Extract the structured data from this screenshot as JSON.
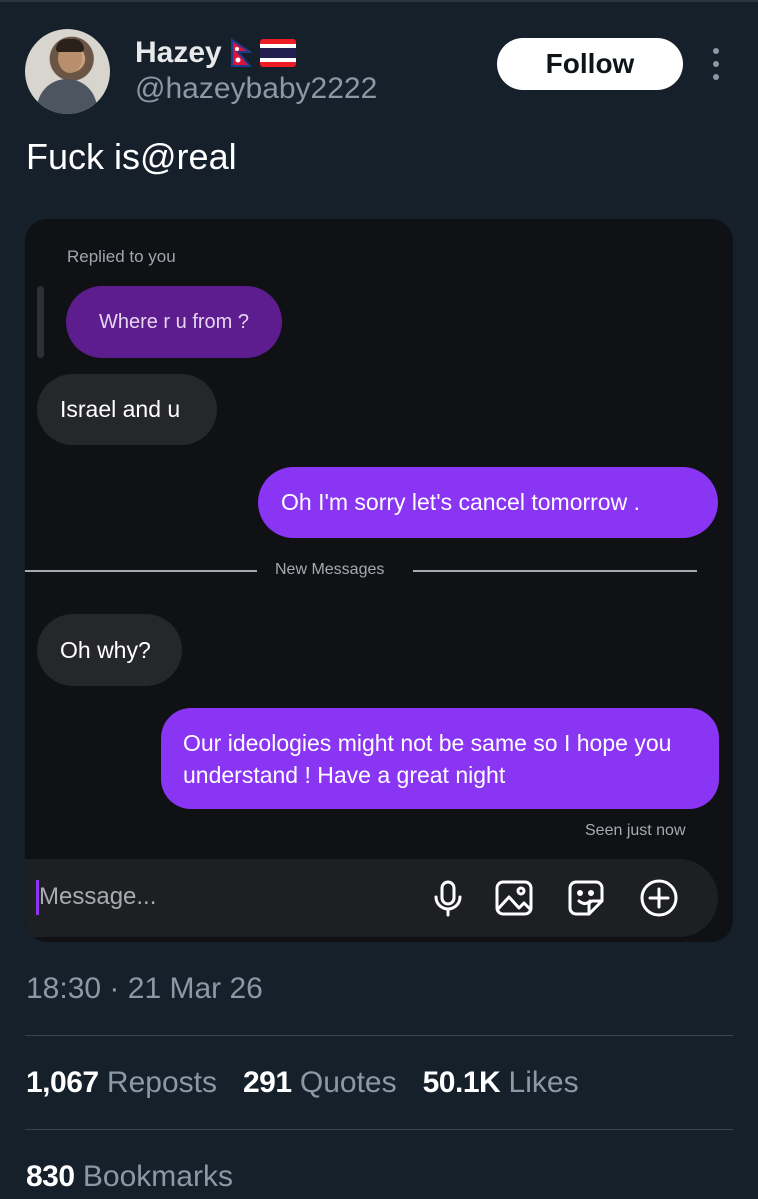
{
  "author": {
    "name": "Hazey",
    "flags": [
      "nepal-flag",
      "thailand-flag"
    ],
    "handle": "@hazeybaby2222"
  },
  "follow_label": "Follow",
  "tweet_text": "Fuck is@real",
  "dm": {
    "replied_label": "Replied to you",
    "messages": [
      {
        "side": "quoted",
        "text": "Where r u from ?"
      },
      {
        "side": "in",
        "text": "Israel and u"
      },
      {
        "side": "out",
        "text": "Oh I'm sorry let's cancel tomorrow ."
      },
      {
        "side": "in",
        "text": "Oh why?"
      },
      {
        "side": "out",
        "text": "Our ideologies might not be same so I hope you understand ! Have a great night"
      }
    ],
    "divider_label": "New Messages",
    "seen_label": "Seen just now",
    "composer_placeholder": "Message...",
    "composer_icons": [
      "microphone-icon",
      "image-icon",
      "sticker-icon",
      "plus-circle-icon"
    ]
  },
  "meta": {
    "time": "18:30",
    "separator": "·",
    "date": "21 Mar 26"
  },
  "stats": {
    "reposts_count": "1,067",
    "reposts_label": "Reposts",
    "quotes_count": "291",
    "quotes_label": "Quotes",
    "likes_count": "50.1K",
    "likes_label": "Likes",
    "bookmarks_count": "830",
    "bookmarks_label": "Bookmarks"
  },
  "colors": {
    "background": "#15202b",
    "accent_purple": "#8a35f4",
    "quoted_purple": "#5e1d8f"
  }
}
